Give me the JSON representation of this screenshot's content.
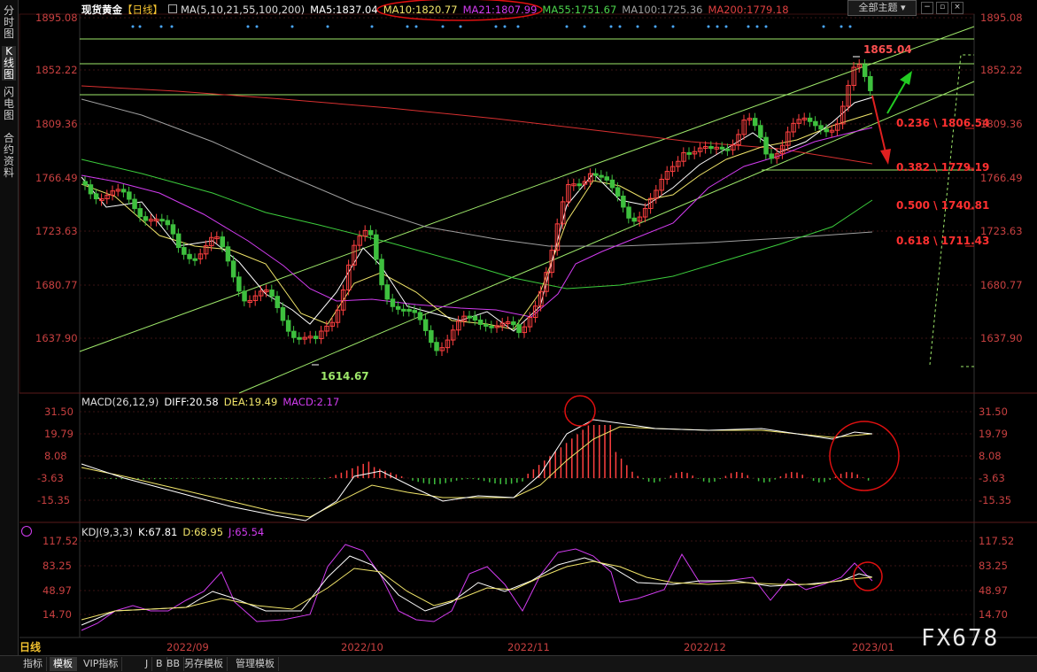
{
  "sidebar": {
    "tabs": [
      {
        "label": "分时图",
        "active": false
      },
      {
        "label": "K线图",
        "active": true
      },
      {
        "label": "闪电图",
        "active": false
      },
      {
        "label": "合约资料",
        "active": false
      }
    ]
  },
  "header": {
    "instrument": "现货黄金",
    "period_tag": "【日线】",
    "ma_label": "MA(5,10,21,55,100,200)",
    "ma5": "MA5:1837.04",
    "ma10": "MA10:1820.77",
    "ma21": "MA21:1807.99",
    "ma55": "MA55:1751.67",
    "ma100": "MA100:1725.36",
    "ma200": "MA200:1779.18",
    "theme_button": "全部主题",
    "colors": {
      "ma5": "#ffffff",
      "ma10": "#f2e66a",
      "ma21": "#d23cf0",
      "ma55": "#4cd44c",
      "ma100": "#a0a0a0",
      "ma200": "#e04040"
    }
  },
  "macd": {
    "label": "MACD(26,12,9)",
    "diff": "DIFF:20.58",
    "dea": "DEA:19.49",
    "macd": "MACD:2.17"
  },
  "kdj": {
    "label": "KDJ(9,3,3)",
    "k": "K:67.81",
    "d": "D:68.95",
    "j": "J:65.54"
  },
  "price_axis": [
    "1895.08",
    "1852.22",
    "1809.36",
    "1766.49",
    "1723.63",
    "1680.77",
    "1637.90"
  ],
  "macd_axis": [
    "31.50",
    "19.79",
    "8.08",
    "-3.63",
    "-15.35"
  ],
  "kdj_axis": [
    "117.52",
    "83.25",
    "48.97",
    "14.70"
  ],
  "date_axis": [
    "2022/09",
    "2022/10",
    "2022/11",
    "2022/12",
    "2023/01"
  ],
  "annotations": {
    "high": "1865.04",
    "low": "1614.67",
    "fib": [
      "0.236 \\ 1806.54",
      "0.382 \\ 1779.19",
      "0.500 \\ 1740.81",
      "0.618 \\ 1711.43"
    ]
  },
  "bottombar": {
    "period": "日线",
    "items": [
      "指标",
      "模板",
      "VIP指标",
      "J",
      "B",
      "BB",
      "另存模板",
      "管理模板"
    ]
  },
  "watermark": "FX678"
}
